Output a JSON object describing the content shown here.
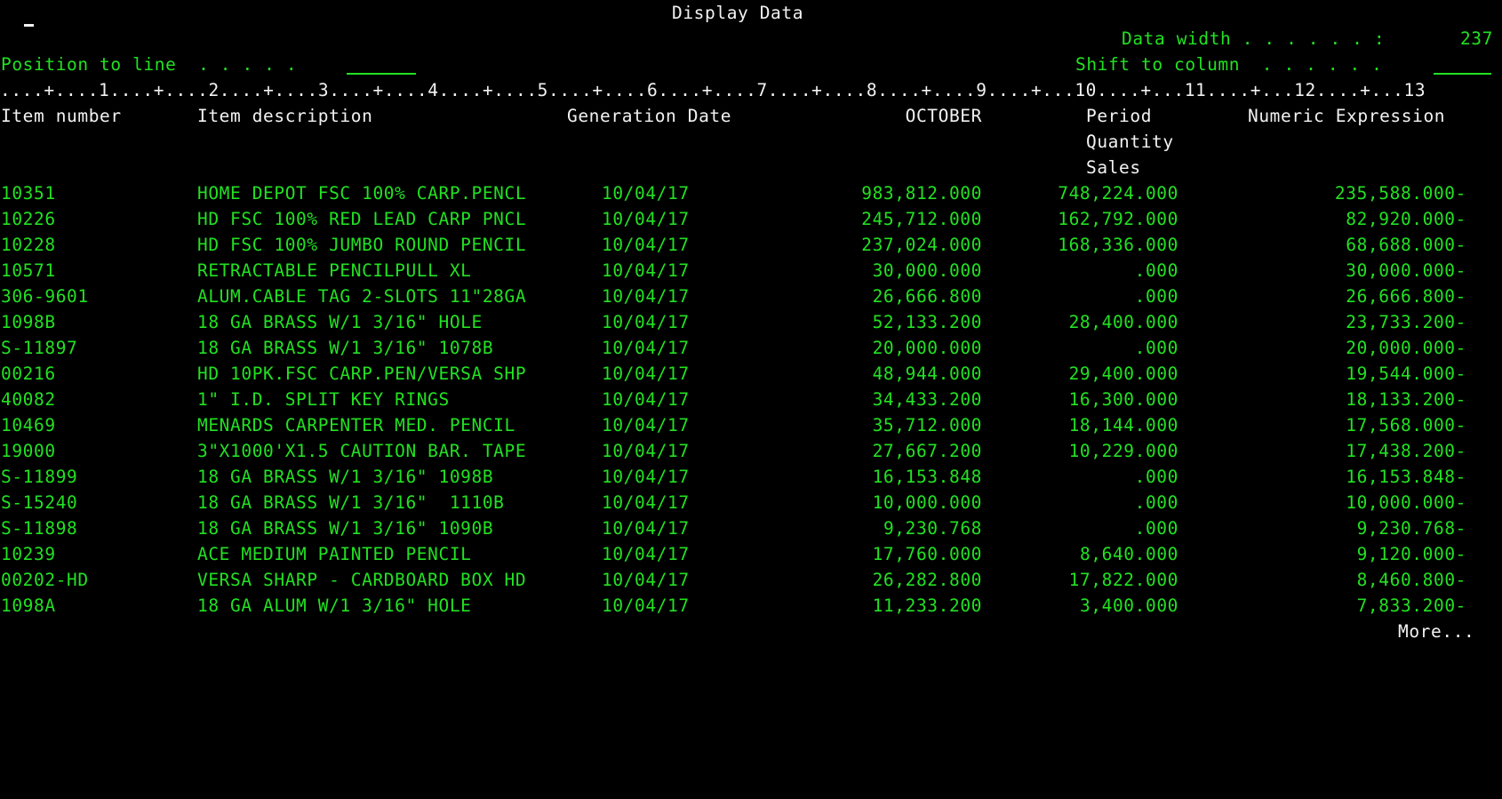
{
  "screen": {
    "title": "Display Data",
    "data_width_label": "Data width . . . . . . :",
    "data_width_value": "237",
    "position_label": "Position to line  . . . . .",
    "shift_label": "Shift to column  . . . . . .",
    "ruler": "....+....1....+....2....+....3....+....4....+....5....+....6....+....7....+....8....+....9....+...10....+...11....+...12....+...13",
    "more_text": "More..."
  },
  "columns": {
    "item_number": "Item number",
    "item_description": "Item description",
    "generation_date": "Generation Date",
    "october": "OCTOBER",
    "period_line1": "Period",
    "period_line2": "Quantity",
    "period_line3": "Sales",
    "numeric_expression": "Numeric Expression"
  },
  "rows": [
    {
      "item": "10351",
      "desc": "HOME DEPOT FSC 100% CARP.PENCL",
      "date": "10/04/17",
      "october": "983,812.000",
      "period": "748,224.000",
      "numeric": "235,588.000-"
    },
    {
      "item": "10226",
      "desc": "HD FSC 100% RED LEAD CARP PNCL",
      "date": "10/04/17",
      "october": "245,712.000",
      "period": "162,792.000",
      "numeric": "82,920.000-"
    },
    {
      "item": "10228",
      "desc": "HD FSC 100% JUMBO ROUND PENCIL",
      "date": "10/04/17",
      "october": "237,024.000",
      "period": "168,336.000",
      "numeric": "68,688.000-"
    },
    {
      "item": "10571",
      "desc": "RETRACTABLE PENCILPULL XL",
      "date": "10/04/17",
      "october": "30,000.000",
      "period": ".000",
      "numeric": "30,000.000-"
    },
    {
      "item": "306-9601",
      "desc": "ALUM.CABLE TAG 2-SLOTS 11\"28GA",
      "date": "10/04/17",
      "october": "26,666.800",
      "period": ".000",
      "numeric": "26,666.800-"
    },
    {
      "item": "1098B",
      "desc": "18 GA BRASS W/1 3/16\" HOLE",
      "date": "10/04/17",
      "october": "52,133.200",
      "period": "28,400.000",
      "numeric": "23,733.200-"
    },
    {
      "item": "S-11897",
      "desc": "18 GA BRASS W/1 3/16\" 1078B",
      "date": "10/04/17",
      "october": "20,000.000",
      "period": ".000",
      "numeric": "20,000.000-"
    },
    {
      "item": "00216",
      "desc": "HD 10PK.FSC CARP.PEN/VERSA SHP",
      "date": "10/04/17",
      "october": "48,944.000",
      "period": "29,400.000",
      "numeric": "19,544.000-"
    },
    {
      "item": "40082",
      "desc": "1\" I.D. SPLIT KEY RINGS",
      "date": "10/04/17",
      "october": "34,433.200",
      "period": "16,300.000",
      "numeric": "18,133.200-"
    },
    {
      "item": "10469",
      "desc": "MENARDS CARPENTER MED. PENCIL",
      "date": "10/04/17",
      "october": "35,712.000",
      "period": "18,144.000",
      "numeric": "17,568.000-"
    },
    {
      "item": "19000",
      "desc": "3\"X1000'X1.5 CAUTION BAR. TAPE",
      "date": "10/04/17",
      "october": "27,667.200",
      "period": "10,229.000",
      "numeric": "17,438.200-"
    },
    {
      "item": "S-11899",
      "desc": "18 GA BRASS W/1 3/16\" 1098B",
      "date": "10/04/17",
      "october": "16,153.848",
      "period": ".000",
      "numeric": "16,153.848-"
    },
    {
      "item": "S-15240",
      "desc": "18 GA BRASS W/1 3/16\"  1110B",
      "date": "10/04/17",
      "october": "10,000.000",
      "period": ".000",
      "numeric": "10,000.000-"
    },
    {
      "item": "S-11898",
      "desc": "18 GA BRASS W/1 3/16\" 1090B",
      "date": "10/04/17",
      "october": "9,230.768",
      "period": ".000",
      "numeric": "9,230.768-"
    },
    {
      "item": "10239",
      "desc": "ACE MEDIUM PAINTED PENCIL",
      "date": "10/04/17",
      "october": "17,760.000",
      "period": "8,640.000",
      "numeric": "9,120.000-"
    },
    {
      "item": "00202-HD",
      "desc": "VERSA SHARP - CARDBOARD BOX HD",
      "date": "10/04/17",
      "october": "26,282.800",
      "period": "17,822.000",
      "numeric": "8,460.800-"
    },
    {
      "item": "1098A",
      "desc": "18 GA ALUM W/1 3/16\" HOLE",
      "date": "10/04/17",
      "october": "11,233.200",
      "period": "3,400.000",
      "numeric": "7,833.200-"
    }
  ]
}
